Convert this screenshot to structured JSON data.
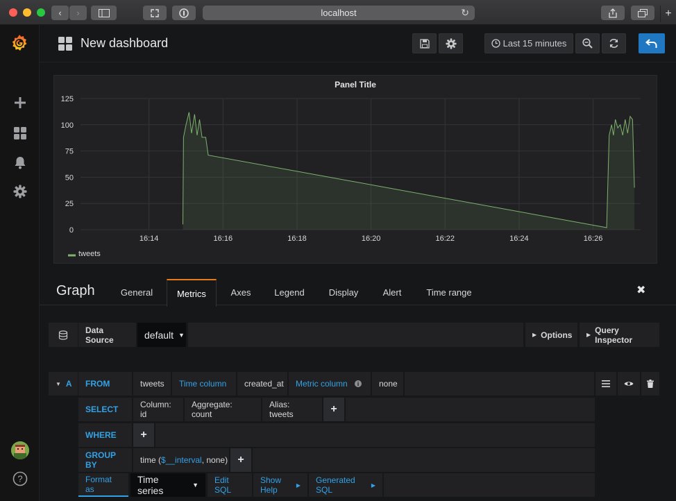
{
  "browser": {
    "url": "localhost"
  },
  "navbar": {
    "title": "New dashboard",
    "time_range": "Last 15 minutes"
  },
  "panel": {
    "title": "Panel Title"
  },
  "chart_data": {
    "type": "line",
    "title": "Panel Title",
    "ylim": [
      0,
      125
    ],
    "y_ticks": [
      "125",
      "100",
      "75",
      "50",
      "25",
      "0"
    ],
    "x_ticks": [
      "16:14",
      "16:16",
      "16:18",
      "16:20",
      "16:22",
      "16:24",
      "16:26"
    ],
    "series": [
      {
        "name": "tweets",
        "color": "#7eb26d",
        "points": [
          [
            "16:14:55",
            5
          ],
          [
            "16:14:56",
            88
          ],
          [
            "16:15:00",
            100
          ],
          [
            "16:15:05",
            112
          ],
          [
            "16:15:09",
            92
          ],
          [
            "16:15:14",
            110
          ],
          [
            "16:15:18",
            90
          ],
          [
            "16:15:22",
            105
          ],
          [
            "16:15:26",
            88
          ],
          [
            "16:15:32",
            88
          ],
          [
            "16:15:36",
            71
          ],
          [
            "16:26:22",
            2
          ],
          [
            "16:26:26",
            90
          ],
          [
            "16:26:30",
            100
          ],
          [
            "16:26:33",
            90
          ],
          [
            "16:26:36",
            105
          ],
          [
            "16:26:40",
            97
          ],
          [
            "16:26:44",
            100
          ],
          [
            "16:26:48",
            90
          ],
          [
            "16:26:52",
            105
          ],
          [
            "16:26:56",
            92
          ],
          [
            "16:27:00",
            108
          ],
          [
            "16:27:04",
            105
          ],
          [
            "16:27:07",
            40
          ]
        ]
      }
    ],
    "legend": "bottom-left",
    "grid": true
  },
  "editor": {
    "title": "Graph",
    "tabs": [
      "General",
      "Metrics",
      "Axes",
      "Legend",
      "Display",
      "Alert",
      "Time range"
    ],
    "active_tab": "Metrics"
  },
  "datasource": {
    "label": "Data Source",
    "value": "default",
    "options_label": "Options",
    "inspector_label": "Query Inspector"
  },
  "query": {
    "ref": "A",
    "from_kw": "FROM",
    "table": "tweets",
    "time_col_kw": "Time column",
    "time_col": "created_at",
    "metric_col_kw": "Metric column",
    "metric_col": "none",
    "select_kw": "SELECT",
    "select_column": "Column: id",
    "select_aggregate": "Aggregate: count",
    "select_alias": "Alias: tweets",
    "where_kw": "WHERE",
    "groupby_kw": "GROUP BY",
    "groupby_prefix": "time (",
    "groupby_var": "$__interval",
    "groupby_suffix": ", none)",
    "format_kw": "Format as",
    "format_value": "Time series",
    "edit_sql": "Edit SQL",
    "show_help": "Show Help",
    "generated_sql": "Generated SQL"
  },
  "colors": {
    "accent": "#33a2e5",
    "series": "#7eb26d",
    "active_tab": "#eb7b18",
    "back_button": "#1f78c1"
  }
}
